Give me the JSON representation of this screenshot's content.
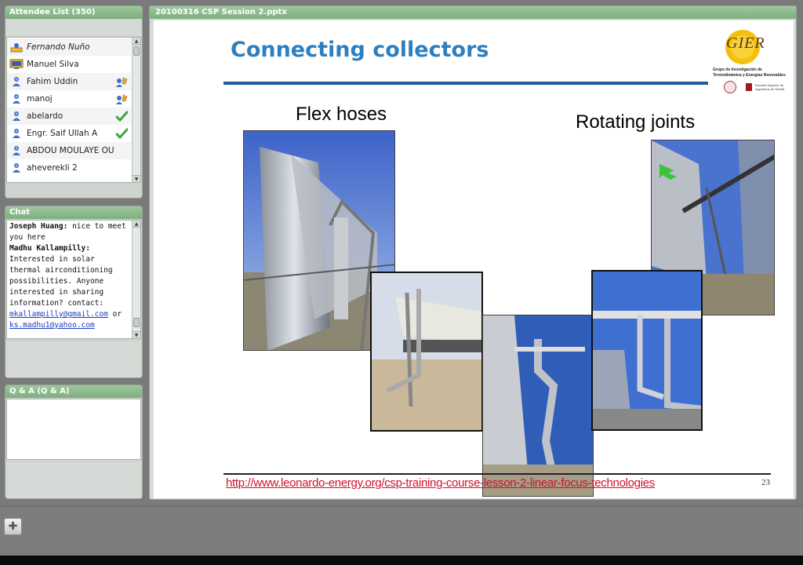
{
  "attendee_panel": {
    "title": "Attendee List (350)",
    "attendees": [
      {
        "name": "Fernando Nuño",
        "icon": "presenter-icon",
        "italic": true,
        "status": ""
      },
      {
        "name": "Manuel Silva",
        "icon": "desktop-user-icon",
        "italic": false,
        "status": ""
      },
      {
        "name": "Fahim Uddin",
        "icon": "user-icon",
        "italic": false,
        "status": "raise-hand-icon"
      },
      {
        "name": "manoj",
        "icon": "user-icon",
        "italic": false,
        "status": "raise-hand-icon"
      },
      {
        "name": "abelardo",
        "icon": "user-icon",
        "italic": false,
        "status": "checkmark-icon"
      },
      {
        "name": "Engr. Saif Ullah A",
        "icon": "user-icon",
        "italic": false,
        "status": "checkmark-icon"
      },
      {
        "name": "ABDOU MOULAYE OU",
        "icon": "user-icon",
        "italic": false,
        "status": ""
      },
      {
        "name": "aheverekli 2",
        "icon": "user-icon",
        "italic": false,
        "status": ""
      }
    ]
  },
  "chat_panel": {
    "title": "Chat",
    "messages": [
      {
        "sender": "Joseph Huang:",
        "text": " nice to meet you here"
      },
      {
        "sender": "Madhu Kallampilly:",
        "text": " Interested in solar thermal airconditioning possibilities. Anyone interested in sharing information? contact:"
      }
    ],
    "link1": "mkallampilly@gmail.com",
    "or_text": " or",
    "link2": "ks.madhu1@yahoo.com"
  },
  "qa_panel": {
    "title": "Q & A (Q & A)"
  },
  "slide_window": {
    "title": "20100316 CSP Session 2.pptx"
  },
  "slide": {
    "title": "Connecting collectors",
    "caption_left": "Flex hoses",
    "caption_right": "Rotating joints",
    "footer_link": "http://www.leonardo-energy.org/csp-training-course-lesson-2-linear-focus-technologies",
    "page_number": "23",
    "logo_text": "GIER",
    "logo_sub1": "Grupo de Investigación de",
    "logo_sub2": "Termodinámica y Energías Renovables",
    "logo_partner": "Escuela Superior de Ingenieros de Sevilla"
  },
  "colors": {
    "panel_header": "#8cbb8c",
    "slide_title": "#2e7fbf",
    "footer_link": "#d0112b"
  }
}
